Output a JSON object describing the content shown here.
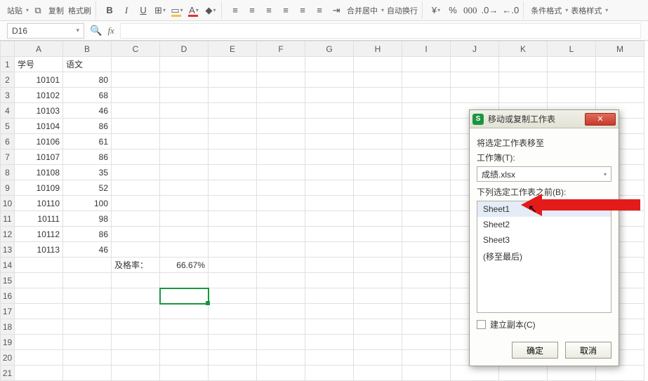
{
  "toolbar": {
    "paste_label": "站贴",
    "copy_label": "复制",
    "format_painter_label": "格式刷",
    "merge_center_label": "合并居中",
    "wrap_text_label": "自动换行",
    "conditional_fmt_label": "条件格式",
    "table_style_label": "表格样式"
  },
  "namebox": {
    "value": "D16",
    "fx_label": "fx"
  },
  "columns": [
    "A",
    "B",
    "C",
    "D",
    "E",
    "F",
    "G",
    "H",
    "I",
    "J",
    "K",
    "L",
    "M"
  ],
  "rows_visible": [
    1,
    2,
    3,
    4,
    5,
    6,
    7,
    8,
    9,
    10,
    11,
    12,
    13,
    14,
    15,
    16,
    17,
    18,
    19,
    20,
    21
  ],
  "headers": {
    "col_a": "学号",
    "col_b": "语文"
  },
  "chart_data": {
    "type": "table",
    "columns": [
      "学号",
      "语文"
    ],
    "rows": [
      [
        10101,
        80
      ],
      [
        10102,
        68
      ],
      [
        10103,
        46
      ],
      [
        10104,
        86
      ],
      [
        10106,
        61
      ],
      [
        10107,
        86
      ],
      [
        10108,
        35
      ],
      [
        10109,
        52
      ],
      [
        10110,
        100
      ],
      [
        10111,
        98
      ],
      [
        10112,
        86
      ],
      [
        10113,
        46
      ]
    ],
    "summary": {
      "label": "及格率：",
      "value": "66.67%"
    }
  },
  "dialog": {
    "title": "移动或复制工作表",
    "move_to_label": "将选定工作表移至",
    "workbook_label": "工作簿(T):",
    "workbook_value": "成绩.xlsx",
    "before_label": "下列选定工作表之前(B):",
    "sheets": [
      "Sheet1",
      "Sheet2",
      "Sheet3",
      "(移至最后)"
    ],
    "selected_sheet_index": 0,
    "create_copy_label": "建立副本(C)",
    "ok_label": "确定",
    "cancel_label": "取消"
  },
  "active_cell": "D16"
}
